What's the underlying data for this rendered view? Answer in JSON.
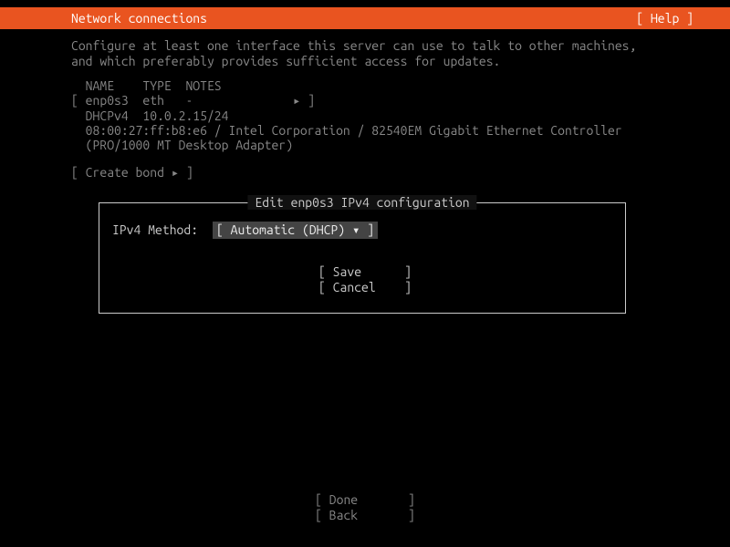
{
  "header": {
    "title": "Network connections",
    "help": "[ Help ]"
  },
  "instructions": {
    "line1": "Configure at least one interface this server can use to talk to other machines,",
    "line2": "and which preferably provides sufficient access for updates."
  },
  "table": {
    "headers": "  NAME    TYPE  NOTES",
    "row": "[ enp0s3  eth   -              ▸ ]",
    "dhcp": "  DHCPv4  10.0.2.15/24",
    "mac": "  08:00:27:ff:b8:e6 / Intel Corporation / 82540EM Gigabit Ethernet Controller",
    "adapter": "  (PRO/1000 MT Desktop Adapter)"
  },
  "create_bond": "[ Create bond ▸ ]",
  "dialog": {
    "title": " Edit enp0s3 IPv4 configuration ",
    "method_label": "IPv4 Method:",
    "method_value": "[ Automatic (DHCP) ▾ ]",
    "save": "[ Save      ]",
    "cancel": "[ Cancel    ]"
  },
  "footer": {
    "done": "[ Done       ]",
    "back": "[ Back       ]"
  }
}
